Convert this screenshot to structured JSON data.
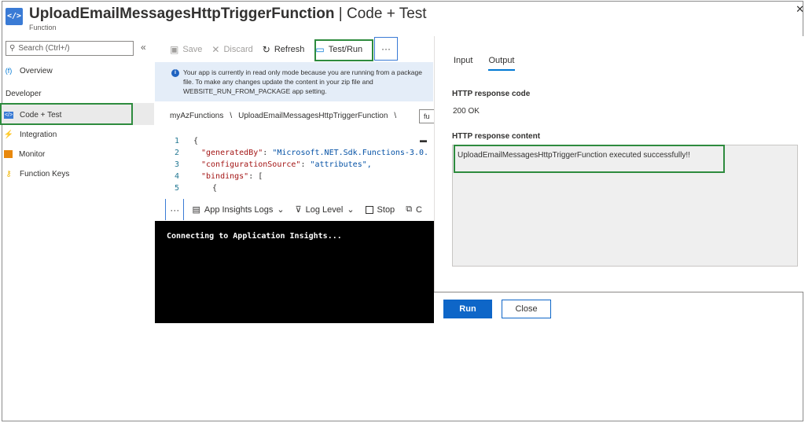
{
  "header": {
    "icon": "function-code-icon",
    "title_name": "UploadEmailMessagesHttpTriggerFunction",
    "title_sep": "|",
    "title_section": "Code + Test",
    "subtitle": "Function",
    "close_glyph": "✕"
  },
  "sidebar": {
    "search_placeholder": "Search (Ctrl+/)",
    "collapse_glyph": "«",
    "overview_label": "Overview",
    "section_heading": "Developer",
    "items": [
      {
        "label": "Code + Test",
        "icon": "code-icon"
      },
      {
        "label": "Integration",
        "icon": "lightning-icon"
      },
      {
        "label": "Monitor",
        "icon": "monitor-icon"
      },
      {
        "label": "Function Keys",
        "icon": "key-icon"
      }
    ]
  },
  "toolbar": {
    "save": "Save",
    "discard": "Discard",
    "refresh": "Refresh",
    "test_run": "Test/Run",
    "more": "···"
  },
  "info": {
    "text": "Your app is currently in read only mode because you are running from a package file. To make any changes update the content in your zip file and WEBSITE_RUN_FROM_PACKAGE app setting."
  },
  "breadcrumb": {
    "app": "myAzFunctions",
    "sep": "\\",
    "function": "UploadEmailMessagesHttpTriggerFunction",
    "field_value": "fu"
  },
  "editor": {
    "lines": [
      {
        "num": "1",
        "text": "{"
      },
      {
        "num": "2",
        "key": "\"generatedBy\"",
        "value": "\"Microsoft.NET.Sdk.Functions-3.0."
      },
      {
        "num": "3",
        "key": "\"configurationSource\"",
        "value": "\"attributes\","
      },
      {
        "num": "4",
        "key": "\"bindings\"",
        "value": "["
      },
      {
        "num": "5",
        "text": "{"
      }
    ]
  },
  "logbar": {
    "more": "···",
    "insights": "App Insights Logs",
    "level": "Log Level",
    "stop": "Stop",
    "copy_partial": "C"
  },
  "console": {
    "text": "Connecting to Application Insights..."
  },
  "panel": {
    "tabs": [
      "Input",
      "Output"
    ],
    "active_tab": "Output",
    "code_label": "HTTP response code",
    "code_value": "200 OK",
    "content_label": "HTTP response content",
    "content_value": "UploadEmailMessagesHttpTriggerFunction executed successfully!!"
  },
  "buttons": {
    "run": "Run",
    "close": "Close"
  },
  "colors": {
    "accent": "#0e66c8",
    "highlight_box": "#2e8b3e",
    "info_bg": "#e4edf8"
  }
}
